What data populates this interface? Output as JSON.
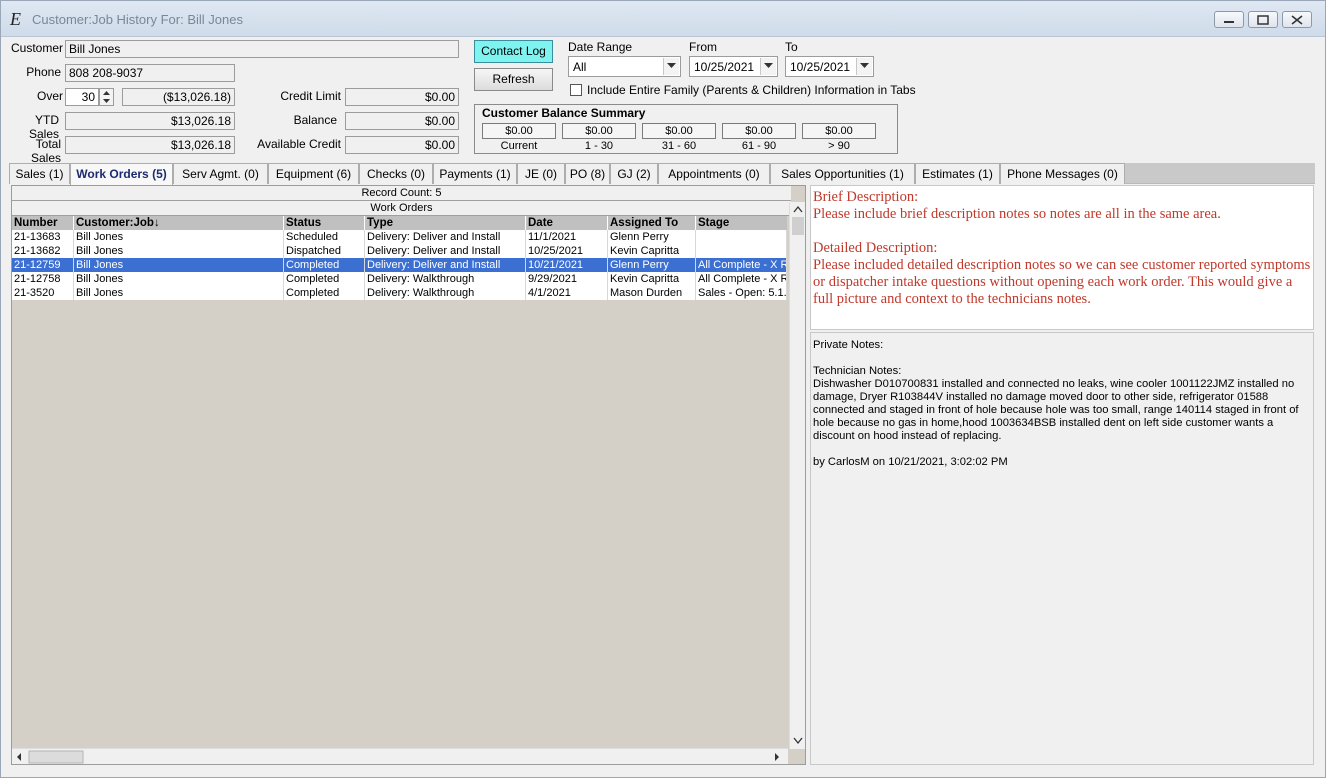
{
  "window": {
    "title": "Customer:Job History For: Bill Jones"
  },
  "form": {
    "customer_label": "Customer",
    "customer_value": "Bill Jones",
    "phone_label": "Phone",
    "phone_value": "808 208-9037",
    "over_label": "Over",
    "over_days": "30",
    "over_amount": "($13,026.18)",
    "ytd_label": "YTD Sales",
    "ytd_value": "$13,026.18",
    "total_label": "Total Sales",
    "total_value": "$13,026.18",
    "credit_limit_label": "Credit Limit",
    "credit_limit_value": "$0.00",
    "balance_label": "Balance",
    "balance_value": "$0.00",
    "available_label": "Available Credit",
    "available_value": "$0.00",
    "contact_log": "Contact Log",
    "refresh": "Refresh",
    "date_range_label": "Date Range",
    "date_range_value": "All",
    "from_label": "From",
    "from_value": "10/25/2021",
    "to_label": "To",
    "to_value": "10/25/2021",
    "family_checkbox": "Include Entire Family (Parents & Children) Information in Tabs"
  },
  "summary": {
    "title": "Customer Balance Summary",
    "buckets": [
      {
        "value": "$0.00",
        "label": "Current"
      },
      {
        "value": "$0.00",
        "label": "1 - 30"
      },
      {
        "value": "$0.00",
        "label": "31 - 60"
      },
      {
        "value": "$0.00",
        "label": "61 - 90"
      },
      {
        "value": "$0.00",
        "label": "> 90"
      }
    ]
  },
  "tabs": [
    "Sales (1)",
    "Work Orders (5)",
    "Serv Agmt. (0)",
    "Equipment (6)",
    "Checks (0)",
    "Payments (1)",
    "JE (0)",
    "PO (8)",
    "GJ (2)",
    "Appointments (0)",
    "Sales Opportunities (1)",
    "Estimates (1)",
    "Phone Messages (0)"
  ],
  "grid": {
    "record_count": "Record Count: 5",
    "caption": "Work Orders",
    "columns": [
      "Number",
      "Customer:Job↓",
      "Status",
      "Type",
      "Date",
      "Assigned To",
      "Stage"
    ],
    "rows": [
      [
        "21-13683",
        "Bill Jones",
        "Scheduled",
        "Delivery: Deliver and Install",
        "11/1/2021",
        "Glenn Perry",
        ""
      ],
      [
        "21-13682",
        "Bill Jones",
        "Dispatched",
        "Delivery: Deliver and Install",
        "10/25/2021",
        "Kevin Capritta",
        ""
      ],
      [
        "21-12759",
        "Bill Jones",
        "Completed",
        "Delivery: Deliver and Install",
        "10/21/2021",
        "Glenn Perry",
        "All Complete - X Re"
      ],
      [
        "21-12758",
        "Bill Jones",
        "Completed",
        "Delivery: Walkthrough",
        "9/29/2021",
        "Kevin Capritta",
        "All Complete - X Re"
      ],
      [
        "21-3520",
        "Bill Jones",
        "Completed",
        "Delivery: Walkthrough",
        "4/1/2021",
        "Mason Durden",
        "Sales - Open: 5.1."
      ]
    ],
    "selected_row": 2
  },
  "notes": {
    "brief_title": "Brief Description:",
    "brief_text": "Please include brief description notes so notes are all in the same area.",
    "detailed_title": "Detailed Description:",
    "detailed_text": "Please included detailed description notes so we can see customer reported symptoms or dispatcher intake questions without opening each work order. This would give a full picture and context to the technicians notes.",
    "private_label": "Private Notes:",
    "tech_label": "Technician Notes:",
    "tech_text": "Dishwasher D010700831 installed and connected no leaks, wine cooler 1001122JMZ installed no damage, Dryer R103844V installed no damage moved door to other side, refrigerator 01588 connected and staged in front of hole because hole was too small, range 140114 staged in front of hole because no gas in home,hood 1003634BSB installed dent on left side customer wants a discount on hood instead of replacing.",
    "signature": "by CarlosM on 10/21/2021, 3:02:02 PM"
  }
}
